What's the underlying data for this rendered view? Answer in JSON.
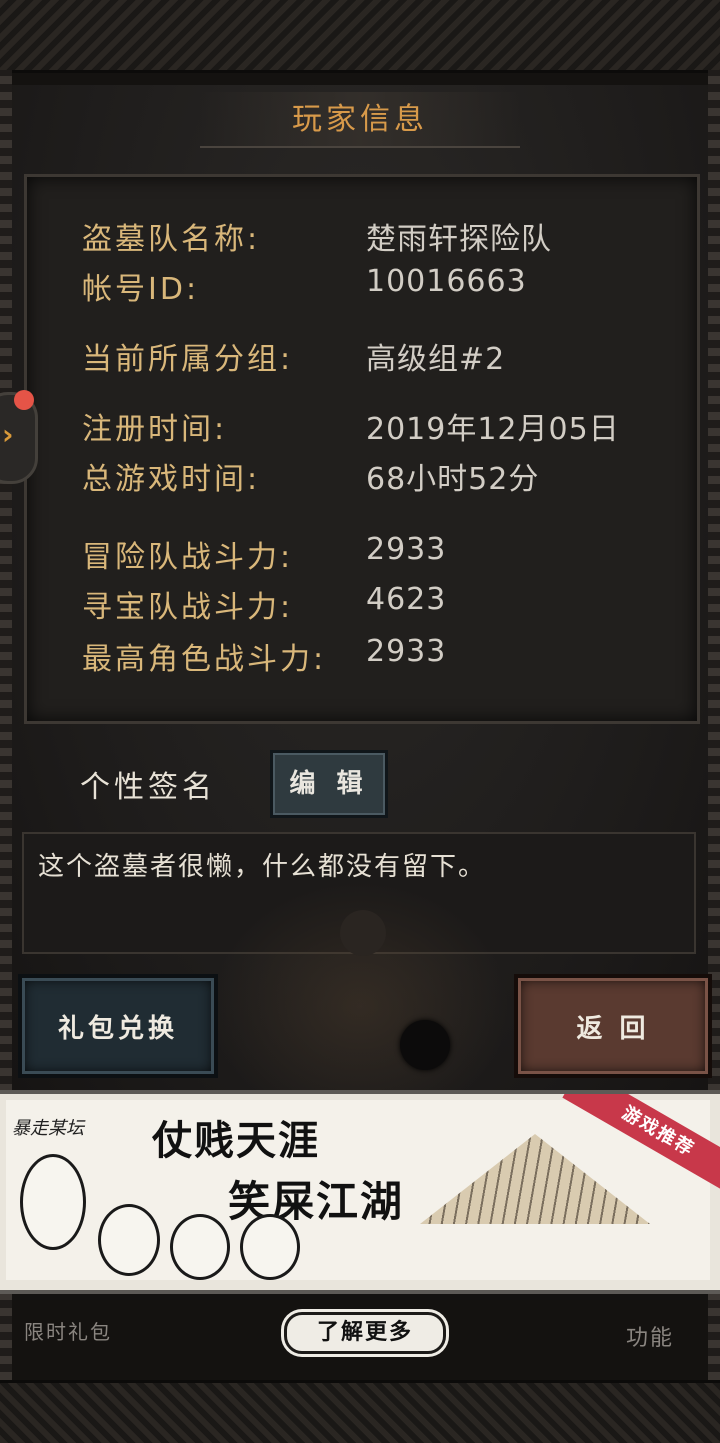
{
  "header": {
    "title": "玩家信息"
  },
  "info": {
    "team_name_label": "盗墓队名称:",
    "team_name_value": "楚雨轩探险队",
    "account_id_label": "帐号ID:",
    "account_id_value": "10016663",
    "group_label": "当前所属分组:",
    "group_value": "高级组#2",
    "register_label": "注册时间:",
    "register_value": "2019年12月05日",
    "playtime_label": "总游戏时间:",
    "playtime_value": "68小时52分",
    "adventure_power_label": "冒险队战斗力:",
    "adventure_power_value": "2933",
    "treasure_power_label": "寻宝队战斗力:",
    "treasure_power_value": "4623",
    "top_role_power_label": "最高角色战斗力:",
    "top_role_power_value": "2933"
  },
  "signature": {
    "label": "个性签名",
    "edit_button": "编 辑",
    "text": "这个盗墓者很懒，什么都没有留下。"
  },
  "buttons": {
    "gift_redeem": "礼包兑换",
    "back": "返 回"
  },
  "ad": {
    "forum": "暴走某坛",
    "line1": "仗贱天涯",
    "line2": "笑屎江湖",
    "ribbon": "游戏推荐",
    "more_button": "了解更多"
  },
  "bottom_nav": {
    "limited_gift": "限时礼包",
    "function": "功能"
  },
  "icons": {
    "side_tab": "chevron-right-icon",
    "notification": "red-dot-icon"
  },
  "colors": {
    "label": "#d9b77a",
    "value": "#d2cdc5",
    "title": "#d89a4a",
    "notification": "#e55447"
  }
}
